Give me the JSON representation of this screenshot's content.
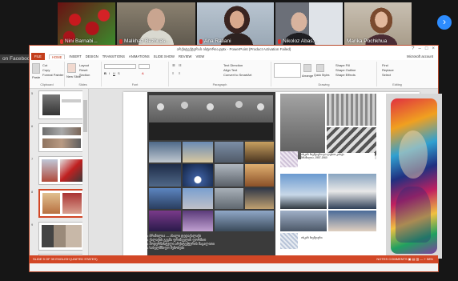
{
  "participants": [
    {
      "name": "Nini Barnabishvili",
      "display": "Nini Barnabi..."
    },
    {
      "name": "Malkhaz Bezhuas...",
      "display": "Malkhaz Bezhuas..."
    },
    {
      "name": "Ana Ratiani",
      "display": "Ana Ratiani"
    },
    {
      "name": "Nikoloz Abas...",
      "display": "Nikoloz Abas..."
    },
    {
      "name": "Marika Pochkhua",
      "display": "Marika Pochkhua"
    }
  ],
  "facebook_tag": "on Facebook",
  "next_icon": "chevron-right-icon",
  "ppt": {
    "window_title": "არქიტექტურას ისტორია.pptx - PowerPoint (Product Activation Failed)",
    "tabs": [
      "FILE",
      "HOME",
      "INSERT",
      "DESIGN",
      "TRANSITIONS",
      "ANIMATIONS",
      "SLIDE SHOW",
      "REVIEW",
      "VIEW"
    ],
    "account": "Microsoft account",
    "ribbon": {
      "paste": "Paste",
      "cut": "Cut",
      "copy": "Copy",
      "format_painter": "Format Painter",
      "clipboard": "Clipboard",
      "new_slide": "New Slide",
      "layout": "Layout",
      "reset": "Reset",
      "section": "Section",
      "slides": "Slides",
      "font": "Font",
      "paragraph": "Paragraph",
      "text_direction": "Text Direction",
      "align_text": "Align Text",
      "convert_smartart": "Convert to SmartArt",
      "arrange": "Arrange",
      "quick_styles": "Quick Styles",
      "shape_fill": "Shape Fill",
      "shape_outline": "Shape Outline",
      "shape_effects": "Shape Effects",
      "drawing": "Drawing",
      "find": "Find",
      "replace": "Replace",
      "select": "Select",
      "editing": "Editing"
    },
    "slide_numbers": [
      "5",
      "6",
      "7",
      "8",
      "9",
      "10"
    ],
    "captions": [
      "ოსკარ ნიემეიერი და ლუსიო კოსტა",
      "ბრაზილია, 1957-1960",
      "ოსკარ ნიემეიერი"
    ],
    "bullets": [
      "ბრაზილია — ახალი დედაქალაქი",
      "ქალაქის გეგმა ფრინველის ფორმით",
      "მოდერნისტული არქიტექტურის მაგალითი",
      "სახელმწიფო შენობები"
    ],
    "status_left": "SLIDE 9 OF 39   ENGLISH (UNITED STATES)",
    "status_right": "NOTES   COMMENTS   ▣  ▤  ▥  —  +  58%"
  }
}
